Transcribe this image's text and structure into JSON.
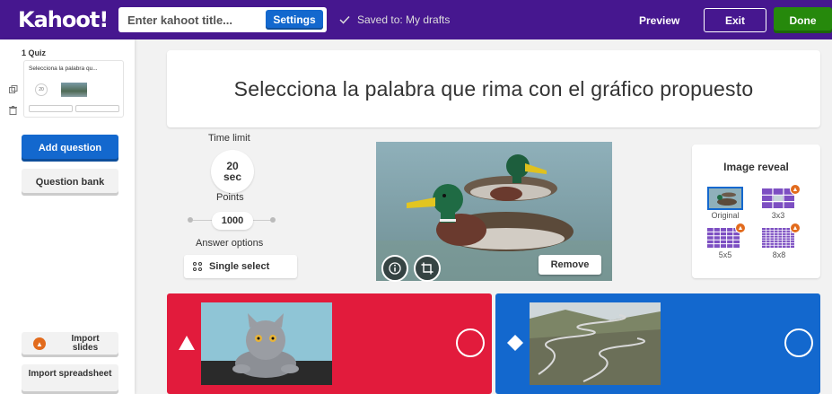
{
  "app": {
    "logo": "Kahoot!"
  },
  "topbar": {
    "title_placeholder": "Enter kahoot title...",
    "settings_label": "Settings",
    "saved_text": "Saved to: My drafts",
    "preview_label": "Preview",
    "exit_label": "Exit",
    "done_label": "Done",
    "colors": {
      "bar": "#46178f",
      "settings": "#1368ce",
      "done": "#26890c"
    }
  },
  "sidebar": {
    "slide": {
      "label": "1 Quiz",
      "title": "Selecciona la palabra qu...",
      "time": "20"
    },
    "add_question_label": "Add question",
    "question_bank_label": "Question bank",
    "import_slides_label": "Import slides",
    "import_spreadsheet_label": "Import spreadsheet"
  },
  "question": {
    "text": "Selecciona la palabra que rima con el gráfico propuesto"
  },
  "settings": {
    "time_limit_label": "Time limit",
    "time_value": "20",
    "time_unit": "sec",
    "points_label": "Points",
    "points_value": "1000",
    "answer_options_label": "Answer options",
    "answer_option_value": "Single select"
  },
  "media": {
    "remove_label": "Remove",
    "info_icon": "info-icon",
    "crop_icon": "crop-icon"
  },
  "image_reveal": {
    "title": "Image reveal",
    "options": [
      {
        "label": "Original",
        "selected": true
      },
      {
        "label": "3x3",
        "locked": true
      },
      {
        "label": "5x5",
        "locked": true
      },
      {
        "label": "8x8",
        "locked": true
      }
    ],
    "badge_color": "#e26b1d"
  },
  "answers": [
    {
      "shape": "triangle",
      "color": "#e21b3c",
      "image": "cat"
    },
    {
      "shape": "diamond",
      "color": "#1368ce",
      "image": "winding-road"
    }
  ]
}
